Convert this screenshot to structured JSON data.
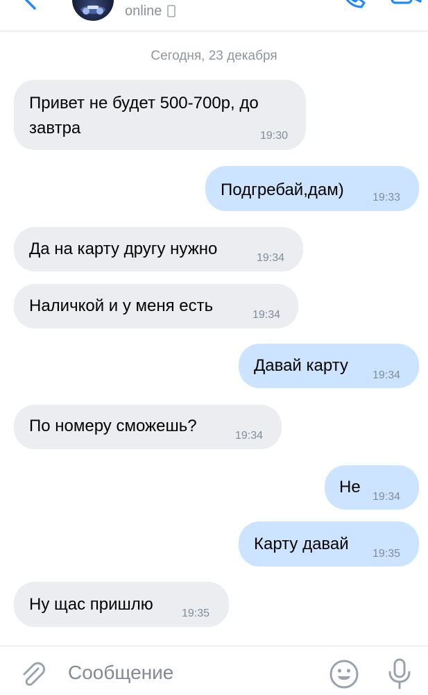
{
  "header": {
    "status": "online"
  },
  "date_separator": "Сегодня, 23 декабря",
  "messages": [
    {
      "direction": "in",
      "lines": [
        "Привет не будет 500-700р, до",
        "завтра"
      ],
      "time": "19:30"
    },
    {
      "direction": "out",
      "lines": [
        "Подгребай,дам)"
      ],
      "time": "19:33"
    },
    {
      "direction": "in",
      "lines": [
        "Да на карту другу нужно"
      ],
      "time": "19:34"
    },
    {
      "direction": "in",
      "lines": [
        "Наличкой и у меня есть"
      ],
      "time": "19:34"
    },
    {
      "direction": "out",
      "lines": [
        "Давай карту"
      ],
      "time": "19:34"
    },
    {
      "direction": "in",
      "lines": [
        "По номеру сможешь?"
      ],
      "time": "19:34"
    },
    {
      "direction": "out",
      "lines": [
        "Не"
      ],
      "time": "19:34"
    },
    {
      "direction": "out",
      "lines": [
        "Карту давай"
      ],
      "time": "19:35"
    },
    {
      "direction": "in",
      "lines": [
        "Ну щас пришлю"
      ],
      "time": "19:35"
    }
  ],
  "composer": {
    "placeholder": "Сообщение"
  },
  "colors": {
    "incoming_bubble": "#ebedf0",
    "outgoing_bubble": "#cce4ff",
    "accent": "#2688eb",
    "icon_gray": "#99a2ad"
  },
  "icons": [
    "back-arrow",
    "avatar",
    "mobile-phone",
    "phone-call",
    "video-camera",
    "paperclip",
    "emoji",
    "microphone"
  ]
}
